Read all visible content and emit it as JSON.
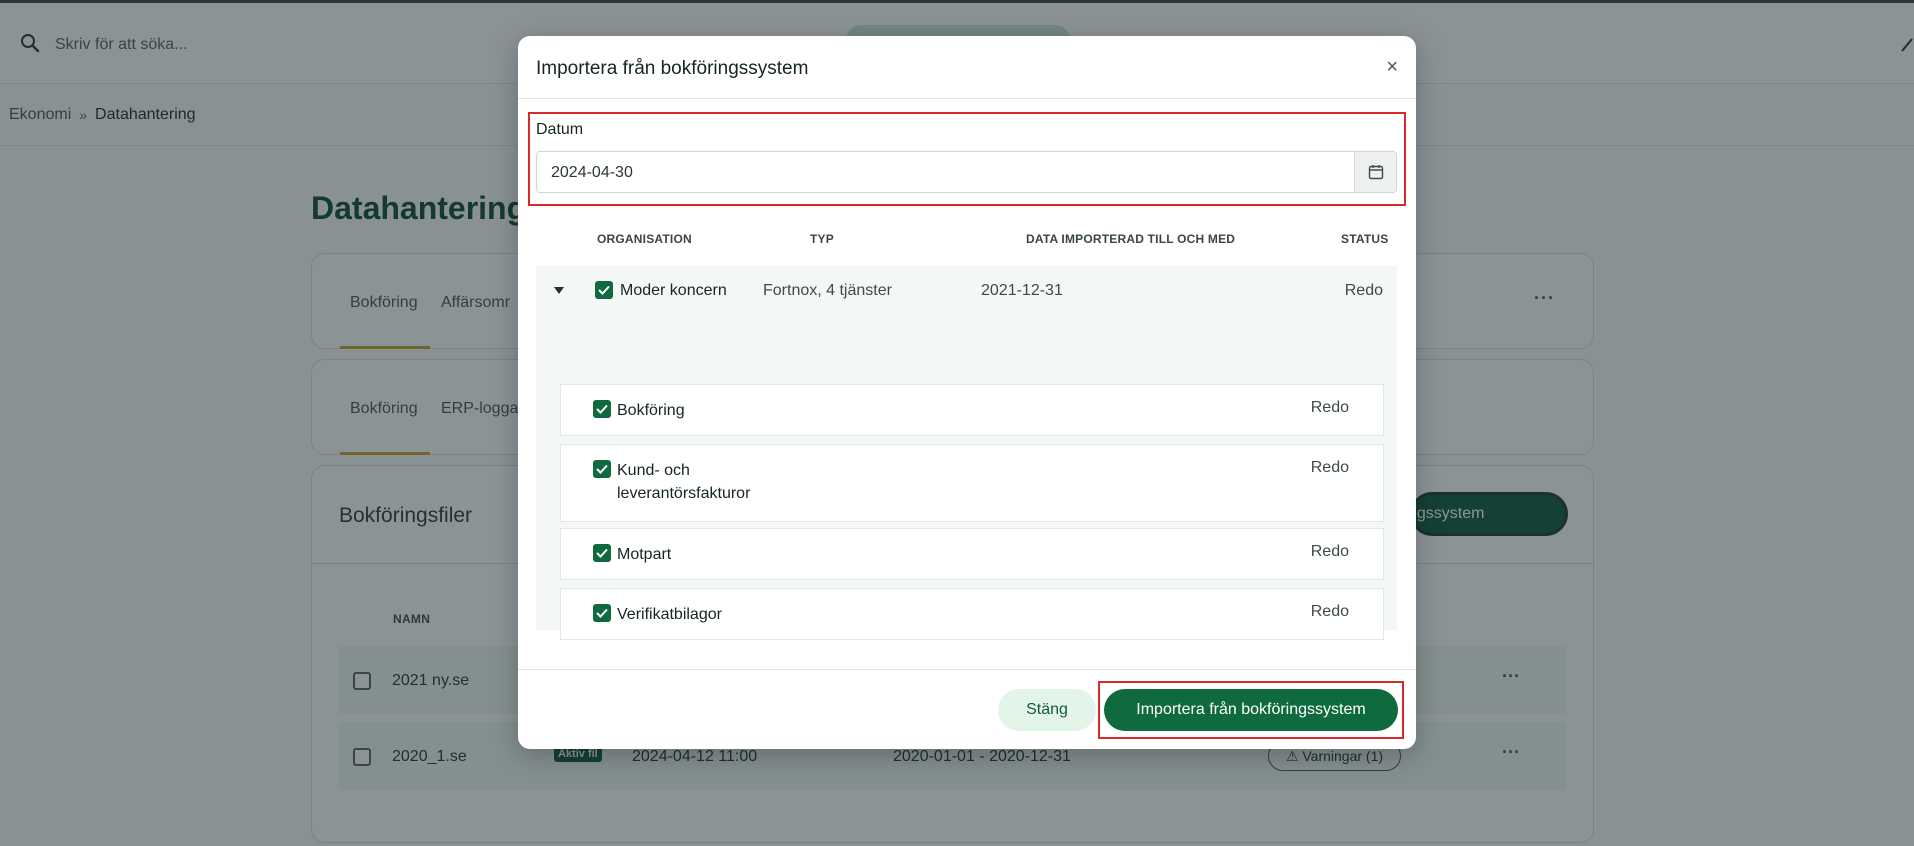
{
  "header": {
    "search_placeholder": "Skriv för att söka..."
  },
  "breadcrumb": {
    "items": [
      "Ekonomi",
      "Datahantering"
    ],
    "separator": "»"
  },
  "page": {
    "title": "Datahantering"
  },
  "tabs_primary": [
    "Bokföring",
    "Affärsomr"
  ],
  "tabs_secondary": [
    "Bokföring",
    "ERP-loggar"
  ],
  "files_card": {
    "heading": "Bokföringsfiler",
    "action_button": "Importera från bokföringssystem",
    "column_name": "NAMN",
    "rows": [
      {
        "name": "2021 ny.se",
        "badge": "",
        "date": "",
        "range": "",
        "warnings": ""
      },
      {
        "name": "2020_1.se",
        "badge": "Aktiv fil",
        "date": "2024-04-12 11:00",
        "range": "2020-01-01 - 2020-12-31",
        "warnings": "⚠ Varningar (1)"
      }
    ]
  },
  "modal": {
    "title": "Importera från bokföringssystem",
    "close_glyph": "×",
    "date_label": "Datum",
    "date_value": "2024-04-30",
    "columns": {
      "organisation": "ORGANISATION",
      "type": "TYP",
      "imported_until": "DATA IMPORTERAD TILL OCH MED",
      "status": "STATUS"
    },
    "org": {
      "name": "Moder koncern",
      "type": "Fortnox, 4 tjänster",
      "imported_until": "2021-12-31",
      "status": "Redo"
    },
    "services": [
      {
        "line1": "Bokföring",
        "line2": "",
        "status": "Redo"
      },
      {
        "line1": "Kund- och",
        "line2": "leverantörsfakturor",
        "status": "Redo"
      },
      {
        "line1": "Motpart",
        "line2": "",
        "status": "Redo"
      },
      {
        "line1": "Verifikatbilagor",
        "line2": "",
        "status": "Redo"
      }
    ],
    "close_button": "Stäng",
    "import_button": "Importera från bokföringssystem"
  },
  "colors": {
    "brand_green": "#0f6b3e",
    "highlight_red": "#d82a2a",
    "accent_gold": "#c9a227"
  }
}
